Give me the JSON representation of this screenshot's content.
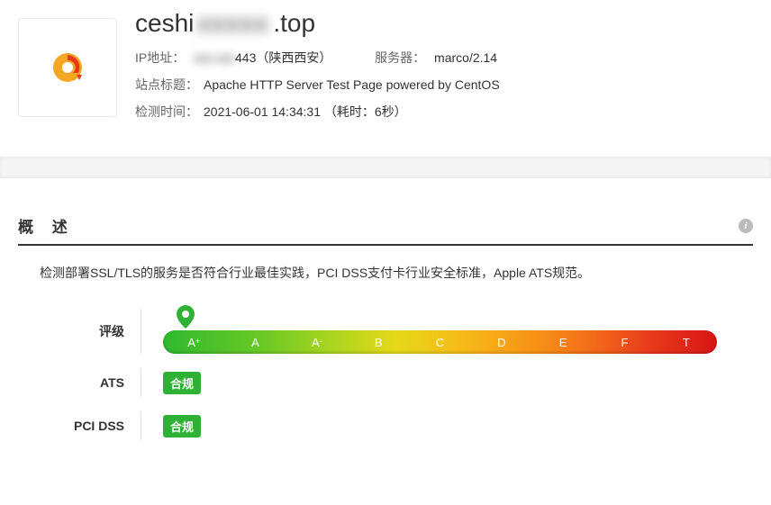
{
  "header": {
    "domain_prefix": "ceshi",
    "domain_blur": "xxxxx",
    "domain_suffix": ".top",
    "ip_label": "IP地址：",
    "ip_blur": "xxx.xxx",
    "ip_port_loc": "443（陕西西安）",
    "server_label": "服务器：",
    "server_value": "marco/2.14",
    "title_label": "站点标题：",
    "title_value": "Apache HTTP Server Test Page powered by CentOS",
    "time_label": "检测时间：",
    "time_value": "2021-06-01 14:34:31 （耗时：6秒）"
  },
  "overview": {
    "title": "概 述",
    "desc": "检测部署SSL/TLS的服务是否符合行业最佳实践，PCI DSS支付卡行业安全标准，Apple ATS规范。",
    "rating_label": "评级",
    "grades": [
      "A",
      "A",
      "A",
      "B",
      "C",
      "D",
      "E",
      "F",
      "T"
    ],
    "grade_sup": [
      "+",
      "",
      "-",
      "",
      "",
      "",
      "",
      "",
      ""
    ],
    "ats_label": "ATS",
    "ats_badge": "合规",
    "pci_label": "PCI DSS",
    "pci_badge": "合规"
  }
}
